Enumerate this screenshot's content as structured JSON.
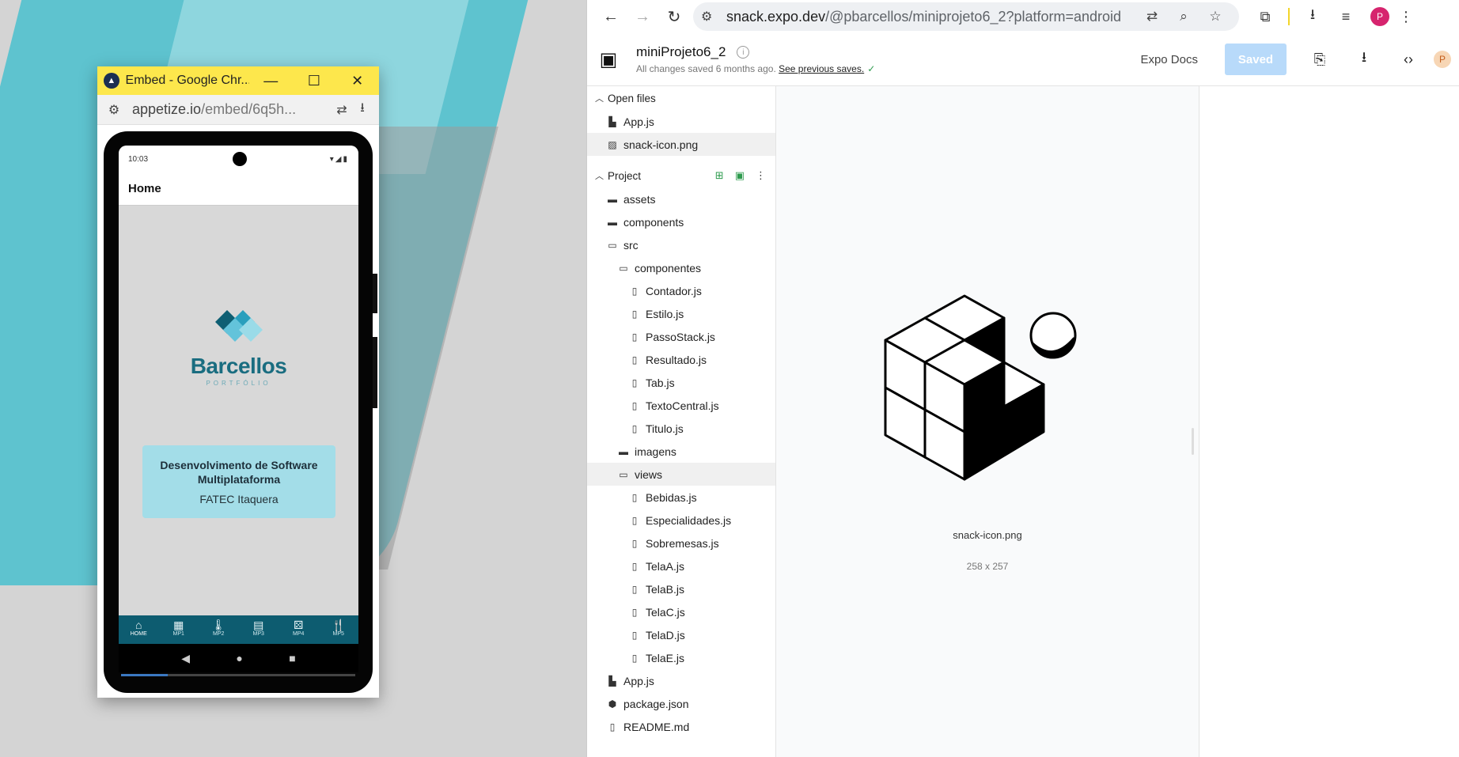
{
  "embed_window": {
    "title": "Embed - Google Chr...",
    "url_main": "appetize.io",
    "url_rest": "/embed/6q5h...",
    "phone": {
      "time": "10:03",
      "header_title": "Home",
      "logo_name": "Barcellos",
      "logo_sub": "PORTFÓLIO",
      "card_title": "Desenvolvimento de Software Multiplataforma",
      "card_sub": "FATEC Itaquera",
      "tabs": [
        {
          "label": "HOME",
          "icon": "⌂"
        },
        {
          "label": "MP1",
          "icon": "▦"
        },
        {
          "label": "MP2",
          "icon": "🌡"
        },
        {
          "label": "MP3",
          "icon": "▤"
        },
        {
          "label": "MP4",
          "icon": "⚄"
        },
        {
          "label": "MP5",
          "icon": "🍴"
        }
      ]
    }
  },
  "browser": {
    "url_main": "snack.expo.dev",
    "url_rest": "/@pbarcellos/miniprojeto6_2?platform=android",
    "avatar_letter": "P"
  },
  "snack": {
    "project_name": "miniProjeto6_2",
    "status_text": "All changes saved 6 months ago.",
    "status_link": "See previous saves.",
    "expo_docs": "Expo Docs",
    "saved_label": "Saved",
    "avatar_letter": "P",
    "open_files_label": "Open files",
    "open_files": [
      "App.js",
      "snack-icon.png"
    ],
    "project_label": "Project",
    "tree": [
      {
        "name": "assets",
        "type": "folder",
        "depth": 0
      },
      {
        "name": "components",
        "type": "folder",
        "depth": 0
      },
      {
        "name": "src",
        "type": "folder-open",
        "depth": 0
      },
      {
        "name": "componentes",
        "type": "folder-open",
        "depth": 1
      },
      {
        "name": "Contador.js",
        "type": "file",
        "depth": 2
      },
      {
        "name": "Estilo.js",
        "type": "file",
        "depth": 2
      },
      {
        "name": "PassoStack.js",
        "type": "file",
        "depth": 2
      },
      {
        "name": "Resultado.js",
        "type": "file",
        "depth": 2
      },
      {
        "name": "Tab.js",
        "type": "file",
        "depth": 2
      },
      {
        "name": "TextoCentral.js",
        "type": "file",
        "depth": 2
      },
      {
        "name": "Titulo.js",
        "type": "file",
        "depth": 2
      },
      {
        "name": "imagens",
        "type": "folder",
        "depth": 1
      },
      {
        "name": "views",
        "type": "folder-open",
        "depth": 1,
        "selected": true
      },
      {
        "name": "Bebidas.js",
        "type": "file",
        "depth": 2
      },
      {
        "name": "Especialidades.js",
        "type": "file",
        "depth": 2
      },
      {
        "name": "Sobremesas.js",
        "type": "file",
        "depth": 2
      },
      {
        "name": "TelaA.js",
        "type": "file",
        "depth": 2
      },
      {
        "name": "TelaB.js",
        "type": "file",
        "depth": 2
      },
      {
        "name": "TelaC.js",
        "type": "file",
        "depth": 2
      },
      {
        "name": "TelaD.js",
        "type": "file",
        "depth": 2
      },
      {
        "name": "TelaE.js",
        "type": "file",
        "depth": 2
      },
      {
        "name": "App.js",
        "type": "js",
        "depth": 0
      },
      {
        "name": "package.json",
        "type": "pkg",
        "depth": 0
      },
      {
        "name": "README.md",
        "type": "file",
        "depth": 0
      }
    ],
    "preview": {
      "file_name": "snack-icon.png",
      "dimensions": "258 x 257"
    }
  }
}
